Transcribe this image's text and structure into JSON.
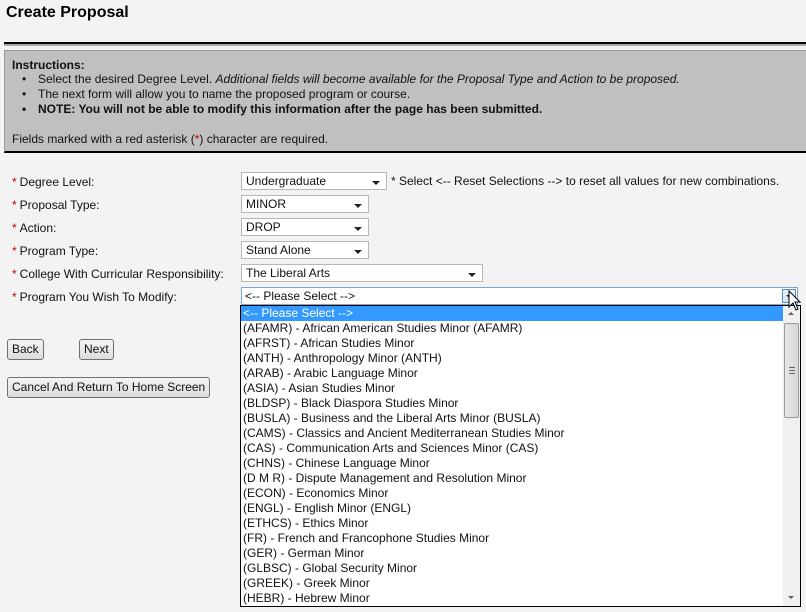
{
  "page": {
    "title": "Create Proposal"
  },
  "instructions": {
    "heading": "Instructions:",
    "bullets": [
      {
        "text": "Select the desired Degree Level. ",
        "italic": "Additional fields will become available for the Proposal Type and Action to be proposed."
      },
      {
        "text": "The next form will allow you to name the proposed program or course."
      },
      {
        "text": "NOTE: You will not be able to modify this information after the page has been submitted."
      }
    ],
    "required_prefix": "Fields marked with a red asterisk (",
    "required_star": "*",
    "required_suffix": ") character are required."
  },
  "form": {
    "required_marker": "*",
    "fields": [
      {
        "label": "Degree Level:",
        "value": "Undergraduate"
      },
      {
        "label": "Proposal Type:",
        "value": "MINOR"
      },
      {
        "label": "Action:",
        "value": "DROP"
      },
      {
        "label": "Program Type:",
        "value": "Stand Alone"
      },
      {
        "label": "College With Curricular Responsibility:",
        "value": "The Liberal Arts"
      },
      {
        "label": "Program You Wish To Modify:",
        "value": "<-- Please Select -->"
      }
    ],
    "degree_hint": "* Select <-- Reset Selections --> to reset all values for new combinations."
  },
  "program_dropdown": {
    "selected_index": 0,
    "options": [
      "<-- Please Select -->",
      "(AFAMR) - African American Studies Minor (AFAMR)",
      "(AFRST) - African Studies Minor",
      "(ANTH) - Anthropology Minor (ANTH)",
      "(ARAB) - Arabic Language Minor",
      "(ASIA) - Asian Studies Minor",
      "(BLDSP) - Black Diaspora Studies Minor",
      "(BUSLA) - Business and the Liberal Arts Minor (BUSLA)",
      "(CAMS) - Classics and Ancient Mediterranean Studies Minor",
      "(CAS) - Communication Arts and Sciences Minor (CAS)",
      "(CHNS) - Chinese Language Minor",
      "(D M R) - Dispute Management and Resolution Minor",
      "(ECON) - Economics Minor",
      "(ENGL) - English Minor (ENGL)",
      "(ETHCS) - Ethics Minor",
      "(FR) - French and Francophone Studies Minor",
      "(GER) - German Minor",
      "(GLBSC) - Global Security Minor",
      "(GREEK) - Greek Minor",
      "(HEBR) - Hebrew Minor"
    ]
  },
  "buttons": {
    "back": "Back",
    "next": "Next",
    "cancel": "Cancel And Return To Home Screen"
  },
  "colors": {
    "required_red": "#c00000",
    "selection_blue": "#3399ff",
    "instructions_bg": "#c0c0c0"
  }
}
